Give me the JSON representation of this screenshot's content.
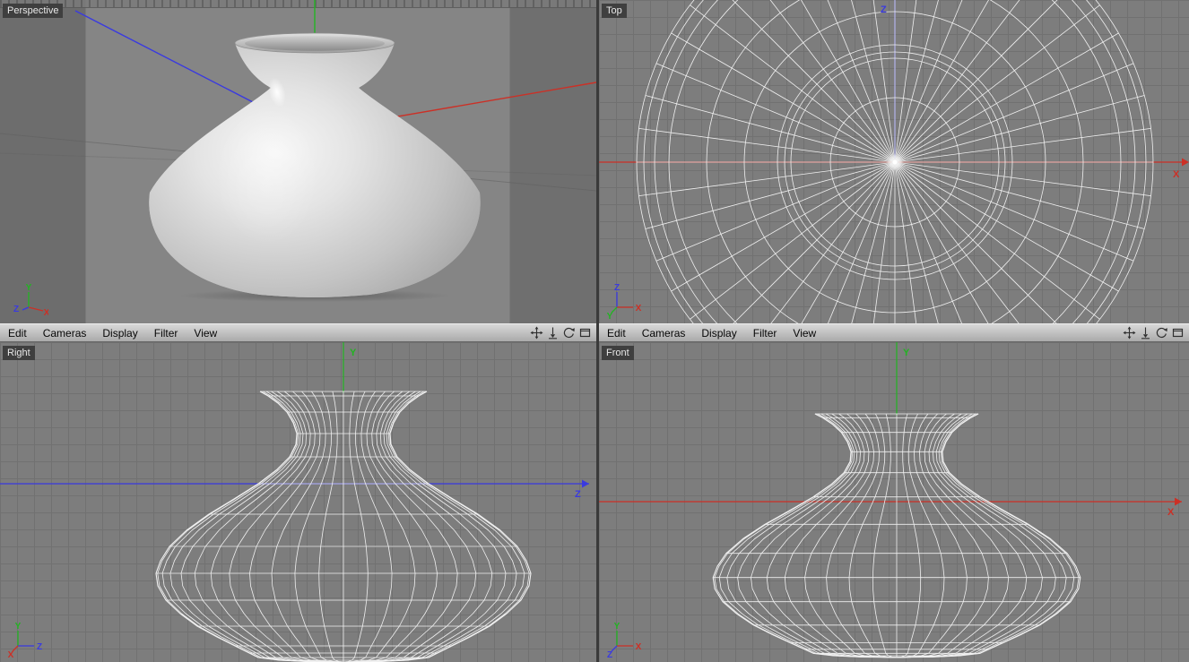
{
  "viewports": {
    "perspective": {
      "label": "Perspective"
    },
    "top": {
      "label": "Top"
    },
    "right": {
      "label": "Right"
    },
    "front": {
      "label": "Front"
    }
  },
  "menus": {
    "items": [
      "Edit",
      "Cameras",
      "Display",
      "Filter",
      "View"
    ]
  },
  "axes": {
    "x": "X",
    "y": "Y",
    "z": "Z"
  },
  "colors": {
    "axis_x": "#cc3026",
    "axis_y": "#22b422",
    "axis_z": "#3a3ae0",
    "wireframe": "#f0f0f0",
    "viewport_bg": "#7d7d7d",
    "grid_line": "#717171",
    "label_chip_bg": "#3f3f3f",
    "menubar_text": "#060606"
  },
  "icons": {
    "viewport_controls": [
      "pan-view",
      "zoom-view",
      "rotate-view",
      "toggle-view"
    ]
  }
}
